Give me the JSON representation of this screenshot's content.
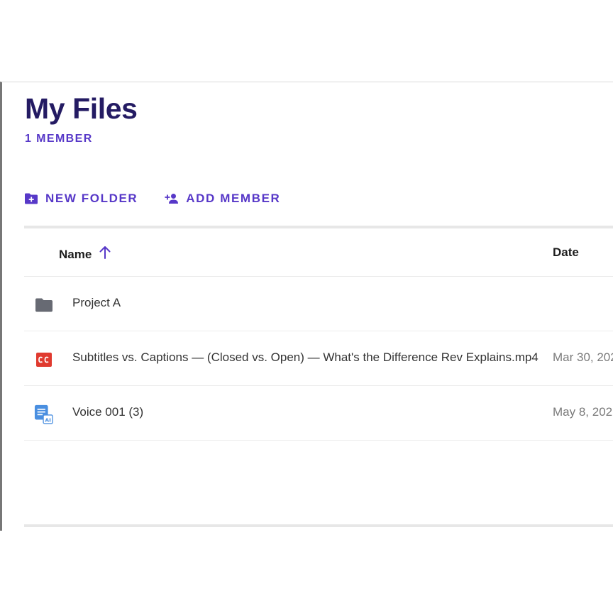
{
  "header": {
    "title": "My Files",
    "member_count": "1 MEMBER"
  },
  "toolbar": {
    "new_folder_label": "NEW FOLDER",
    "new_folder_icon": "folder-plus-icon",
    "add_member_label": "ADD MEMBER",
    "add_member_icon": "person-add-icon"
  },
  "table": {
    "columns": [
      {
        "label": "Name",
        "sort": "ascending",
        "sort_icon": "arrow-up-icon"
      },
      {
        "label": "Date"
      }
    ],
    "rows": [
      {
        "name": "Project A",
        "date": "",
        "icon": "folder-icon",
        "type": "folder"
      },
      {
        "name": "Subtitles vs. Captions — (Closed vs. Open) — What's the Difference Rev Explains.mp4",
        "date": "Mar 30, 202",
        "icon": "cc-icon",
        "type": "caption"
      },
      {
        "name": "Voice 001 (3)",
        "date": "May 8, 202",
        "icon": "ai-transcript-icon",
        "type": "transcript"
      }
    ]
  },
  "colors": {
    "title": "#241b63",
    "accent": "#5738c8",
    "cc_red": "#e03a2f",
    "transcript_blue": "#4a8fe0",
    "folder_gray": "#676a73"
  }
}
